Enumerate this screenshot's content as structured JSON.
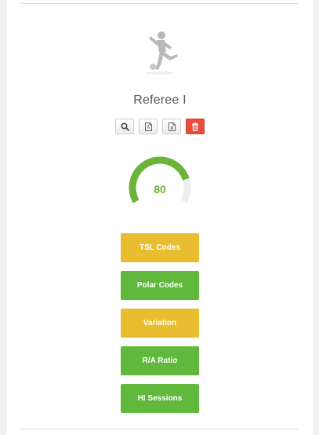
{
  "profile": {
    "name": "Referee I"
  },
  "actions": [
    {
      "icon": "search-icon"
    },
    {
      "icon": "pdf-file-icon"
    },
    {
      "icon": "excel-file-icon"
    },
    {
      "icon": "trash-icon"
    }
  ],
  "gauge": {
    "value": "80",
    "fraction": 0.8,
    "color": "#6ab43a",
    "track_color": "#eeeeee"
  },
  "buttons": {
    "tsl_codes": "TSL Codes",
    "polar_codes": "Polar Codes",
    "variation": "Variation",
    "ra_ratio": "R/A Ratio",
    "hi_sessions": "HI Sessions"
  },
  "colors": {
    "yellow": "#e8bd2f",
    "green": "#60b83c",
    "danger": "#e84c3d"
  }
}
